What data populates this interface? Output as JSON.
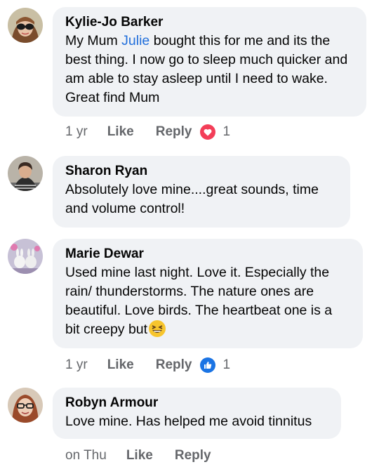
{
  "comments": [
    {
      "author": "Kylie-Jo Barker",
      "text_before": "My Mum ",
      "mention": "Julie",
      "text_after": " bought this for me and its the best thing. I now go to sleep much quicker and am able to stay asleep until I need to wake. Great find Mum",
      "time": "1 yr",
      "like_label": "Like",
      "reply_label": "Reply",
      "reaction_icon": "heart-icon",
      "reaction_count": "1",
      "colors": {
        "reaction": "#f33e58"
      }
    },
    {
      "author": "Sharon Ryan",
      "text": "Absolutely love mine....great sounds, time and volume control!"
    },
    {
      "author": "Marie Dewar",
      "text": "Used mine last night. Love it. Especially the rain/ thunderstorms. The nature ones are beautiful. Love birds. The heartbeat one is a bit creepy but",
      "emoji": "grinning-squinting-face-emoji",
      "time": "1 yr",
      "like_label": "Like",
      "reply_label": "Reply",
      "reaction_icon": "thumbs-up-icon",
      "reaction_count": "1",
      "colors": {
        "reaction": "#1b74e4"
      }
    },
    {
      "author": "Robyn Armour",
      "text": "Love mine. Has helped me avoid tinnitus",
      "time": "on Thu",
      "like_label": "Like",
      "reply_label": "Reply"
    }
  ]
}
